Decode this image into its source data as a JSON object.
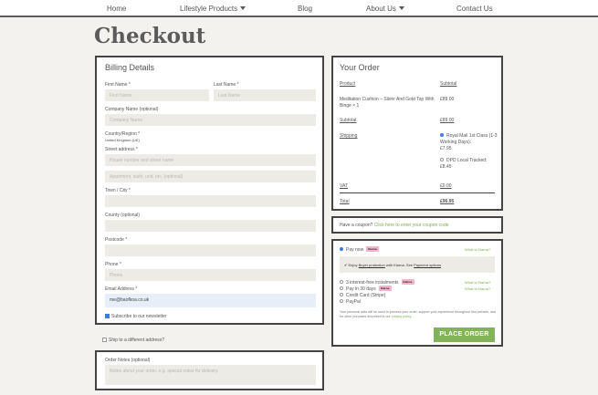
{
  "nav": {
    "home": "Home",
    "lifestyle_products": "Lifestyle Products",
    "blog": "Blog",
    "about_us": "About Us",
    "contact_us": "Contact Us"
  },
  "page_title": "Checkout",
  "billing": {
    "title": "Billing Details",
    "first_name_label": "First Name *",
    "first_name_placeholder": "First Name",
    "last_name_label": "Last Name *",
    "last_name_placeholder": "Last Name",
    "company_label": "Company Name (optional)",
    "company_placeholder": "Company Name",
    "country_label": "Country/Region *",
    "country_value": "United Kingdom (UK)",
    "street_label": "Street address *",
    "street_placeholder_1": "House number and street name",
    "street_placeholder_2": "Apartment, suite, unit, etc. (optional)",
    "town_label": "Town / City *",
    "county_label": "County (optional)",
    "postcode_label": "Postcode *",
    "phone_label": "Phone *",
    "phone_placeholder": "Phone",
    "email_label": "Email Address *",
    "email_value": "me@baofkoa.co.uk",
    "newsletter_label": "Subscribe to our newsletter"
  },
  "ship_different": "Ship to a different address?",
  "order_notes": {
    "label": "Order Notes (optional)",
    "placeholder": "Notes about your order, e.g. special notes for delivery."
  },
  "your_order": {
    "title": "Your Order",
    "product_header": "Product",
    "subtotal_header": "Subtotal",
    "item_name": "Meditation Cushion – Silver And Gold Top With Binge × 1",
    "item_price": "£89.00",
    "subtotal_label": "Subtotal",
    "subtotal_value": "£89.00",
    "shipping_label": "Shipping",
    "shipping_option_1": "Royal Mail 1st Class (1-3 Working Days):",
    "shipping_option_1_price": "£7.95",
    "shipping_option_2": "DPD Local Tracked:",
    "shipping_option_2_price": "£8.45",
    "vat_label": "VAT",
    "vat_value": "£0.00",
    "total_label": "Total",
    "total_value": "£96.95"
  },
  "coupon": {
    "prefix": "Have a coupon?",
    "link": "Click here to enter your coupon code"
  },
  "payment": {
    "pay_now": "Pay now",
    "klarna_badge": "Klarna.",
    "whats_klarna": "What is Klarna?",
    "buyer_protection_prefix": "Enjoy",
    "buyer_protection_link": "Buyer protection",
    "buyer_protection_middle": "with Klarna. See",
    "payment_options_link": "Payment options",
    "interest_free": "3 interest-free instalments",
    "pay_in_30": "Pay in 30 days",
    "credit_card": "Credit Card (Stripe)",
    "paypal": "PayPal",
    "privacy_text": "Your personal data will be used to process your order, support your experience throughout this website, and for other purposes described in our",
    "privacy_link": "privacy policy.",
    "place_order": "PLACE ORDER"
  },
  "colors": {
    "accent_green": "#82b35a",
    "klarna_pink": "#f3b3cc",
    "border_dark": "#444444"
  }
}
